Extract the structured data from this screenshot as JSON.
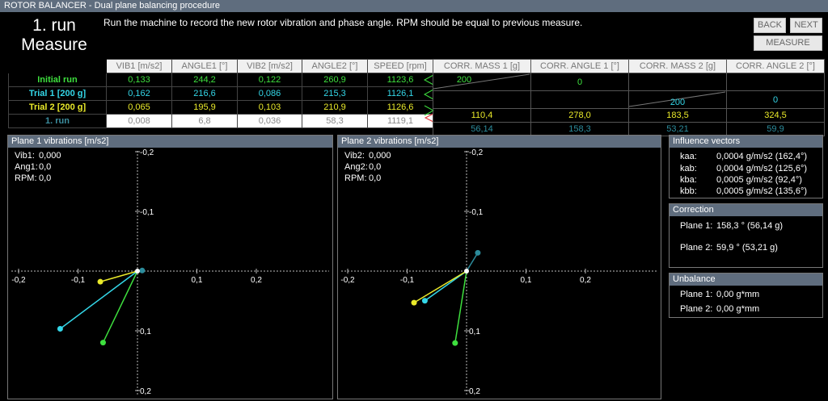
{
  "window": {
    "title": "ROTOR BALANCER - Dual plane balancing procedure"
  },
  "step": {
    "line1": "1. run",
    "line2": "Measure"
  },
  "instruction": "Run the machine to record the new rotor vibration and phase angle. RPM should be equal to previous measure.",
  "buttons": {
    "back": "BACK",
    "next": "NEXT",
    "measure": "MEASURE"
  },
  "table": {
    "headers": [
      "VIB1 [m/s2]",
      "ANGLE1 [°]",
      "VIB2 [m/s2]",
      "ANGLE2 [°]",
      "SPEED [rpm]"
    ],
    "rows": [
      {
        "label": "Initial run",
        "values": [
          "0,133",
          "244,2",
          "0,122",
          "260,9",
          "1123,6"
        ]
      },
      {
        "label": "Trial 1 [200 g]",
        "values": [
          "0,162",
          "216,6",
          "0,086",
          "215,3",
          "1126,1"
        ]
      },
      {
        "label": "Trial 2 [200 g]",
        "values": [
          "0,065",
          "195,9",
          "0,103",
          "210,9",
          "1126,6"
        ]
      },
      {
        "label": "1. run",
        "values": [
          "0,008",
          "6,8",
          "0,036",
          "58,3",
          "1119,1"
        ]
      }
    ]
  },
  "correction_table": {
    "headers": [
      "CORR. MASS 1 [g]",
      "CORR. ANGLE 1 [°]",
      "CORR. MASS 2 [g]",
      "CORR. ANGLE 2 [°]"
    ],
    "trial1": {
      "mass1": "200",
      "angle1": "0"
    },
    "trial2": {
      "mass2": "200",
      "angle2": "0"
    },
    "calc": [
      "110,4",
      "278,0",
      "183,5",
      "324,5"
    ],
    "run": [
      "56,14",
      "158,3",
      "53,21",
      "59,9"
    ]
  },
  "plane1": {
    "title": "Plane 1 vibrations [m/s2]",
    "vib_label": "Vib1:",
    "vib": "0,000",
    "ang_label": "Ang1:",
    "ang": "0,0",
    "rpm_label": "RPM:",
    "rpm": "0,0",
    "points": [
      {
        "name": "initial-run-point",
        "color": "#3ee03e",
        "mag": 0.133,
        "ang": 244.2
      },
      {
        "name": "trial1-point",
        "color": "#34d7e8",
        "mag": 0.162,
        "ang": 216.6
      },
      {
        "name": "trial2-point",
        "color": "#eaea2a",
        "mag": 0.065,
        "ang": 195.9
      },
      {
        "name": "run1-point",
        "color": "#2c8c9c",
        "mag": 0.008,
        "ang": 6.8
      }
    ]
  },
  "plane2": {
    "title": "Plane 2 vibrations [m/s2]",
    "vib_label": "Vib2:",
    "vib": "0,000",
    "ang_label": "Ang2:",
    "ang": "0,0",
    "rpm_label": "RPM:",
    "rpm": "0,0",
    "points": [
      {
        "name": "initial-run-point",
        "color": "#3ee03e",
        "mag": 0.122,
        "ang": 260.9
      },
      {
        "name": "trial1-point",
        "color": "#34d7e8",
        "mag": 0.086,
        "ang": 215.3
      },
      {
        "name": "trial2-point",
        "color": "#eaea2a",
        "mag": 0.103,
        "ang": 210.9
      },
      {
        "name": "run1-point",
        "color": "#2c8c9c",
        "mag": 0.036,
        "ang": 58.3
      }
    ]
  },
  "axis": {
    "ticks_x": [
      "-0,2",
      "-0,1",
      "0,1",
      "0,2"
    ],
    "ticks_y_top": [
      "-0,2",
      "-0,1"
    ],
    "ticks_y_bottom": [
      "0,1",
      "0,2"
    ],
    "range": 0.2
  },
  "influence": {
    "title": "Influence vectors",
    "rows": [
      {
        "k": "kaa:",
        "v": "0,0004 g/m/s2  (162,4°)"
      },
      {
        "k": "kab:",
        "v": "0,0004 g/m/s2  (125,6°)"
      },
      {
        "k": "kba:",
        "v": "0,0005 g/m/s2  (92,4°)"
      },
      {
        "k": "kbb:",
        "v": "0,0005 g/m/s2  (135,6°)"
      }
    ]
  },
  "correction": {
    "title": "Correction",
    "plane1_label": "Plane 1:",
    "plane1": "158,3 ° (56,14 g)",
    "plane2_label": "Plane 2:",
    "plane2": "59,9 ° (53,21 g)"
  },
  "unbalance": {
    "title": "Unbalance",
    "plane1_label": "Plane 1:",
    "plane1": "0,00 g*mm",
    "plane2_label": "Plane 2:",
    "plane2": "0,00 g*mm"
  }
}
